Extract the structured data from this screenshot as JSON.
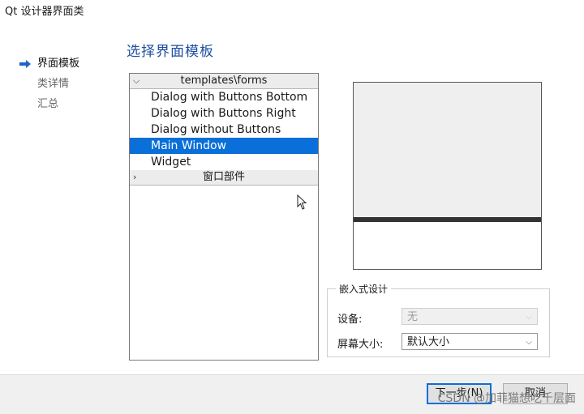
{
  "window": {
    "title": "Qt 设计器界面类"
  },
  "nav": {
    "items": [
      {
        "label": "界面模板",
        "active": true
      },
      {
        "label": "类详情",
        "active": false
      },
      {
        "label": "汇总",
        "active": false
      }
    ]
  },
  "page": {
    "heading": "选择界面模板"
  },
  "tree": {
    "group1": "templates\\forms",
    "items": [
      "Dialog with Buttons Bottom",
      "Dialog with Buttons Right",
      "Dialog without Buttons",
      "Main Window",
      "Widget"
    ],
    "selected_index": 3,
    "group2": "窗口部件"
  },
  "embed": {
    "title": "嵌入式设计",
    "device_label": "设备:",
    "device_value": "无",
    "screen_label": "屏幕大小:",
    "screen_value": "默认大小"
  },
  "buttons": {
    "next": "下一步(N)",
    "cancel": "取消"
  },
  "watermark": "CSDN @加菲猫想吃千层面",
  "colors": {
    "accent": "#0a6fd8",
    "heading": "#1d4fa0"
  }
}
